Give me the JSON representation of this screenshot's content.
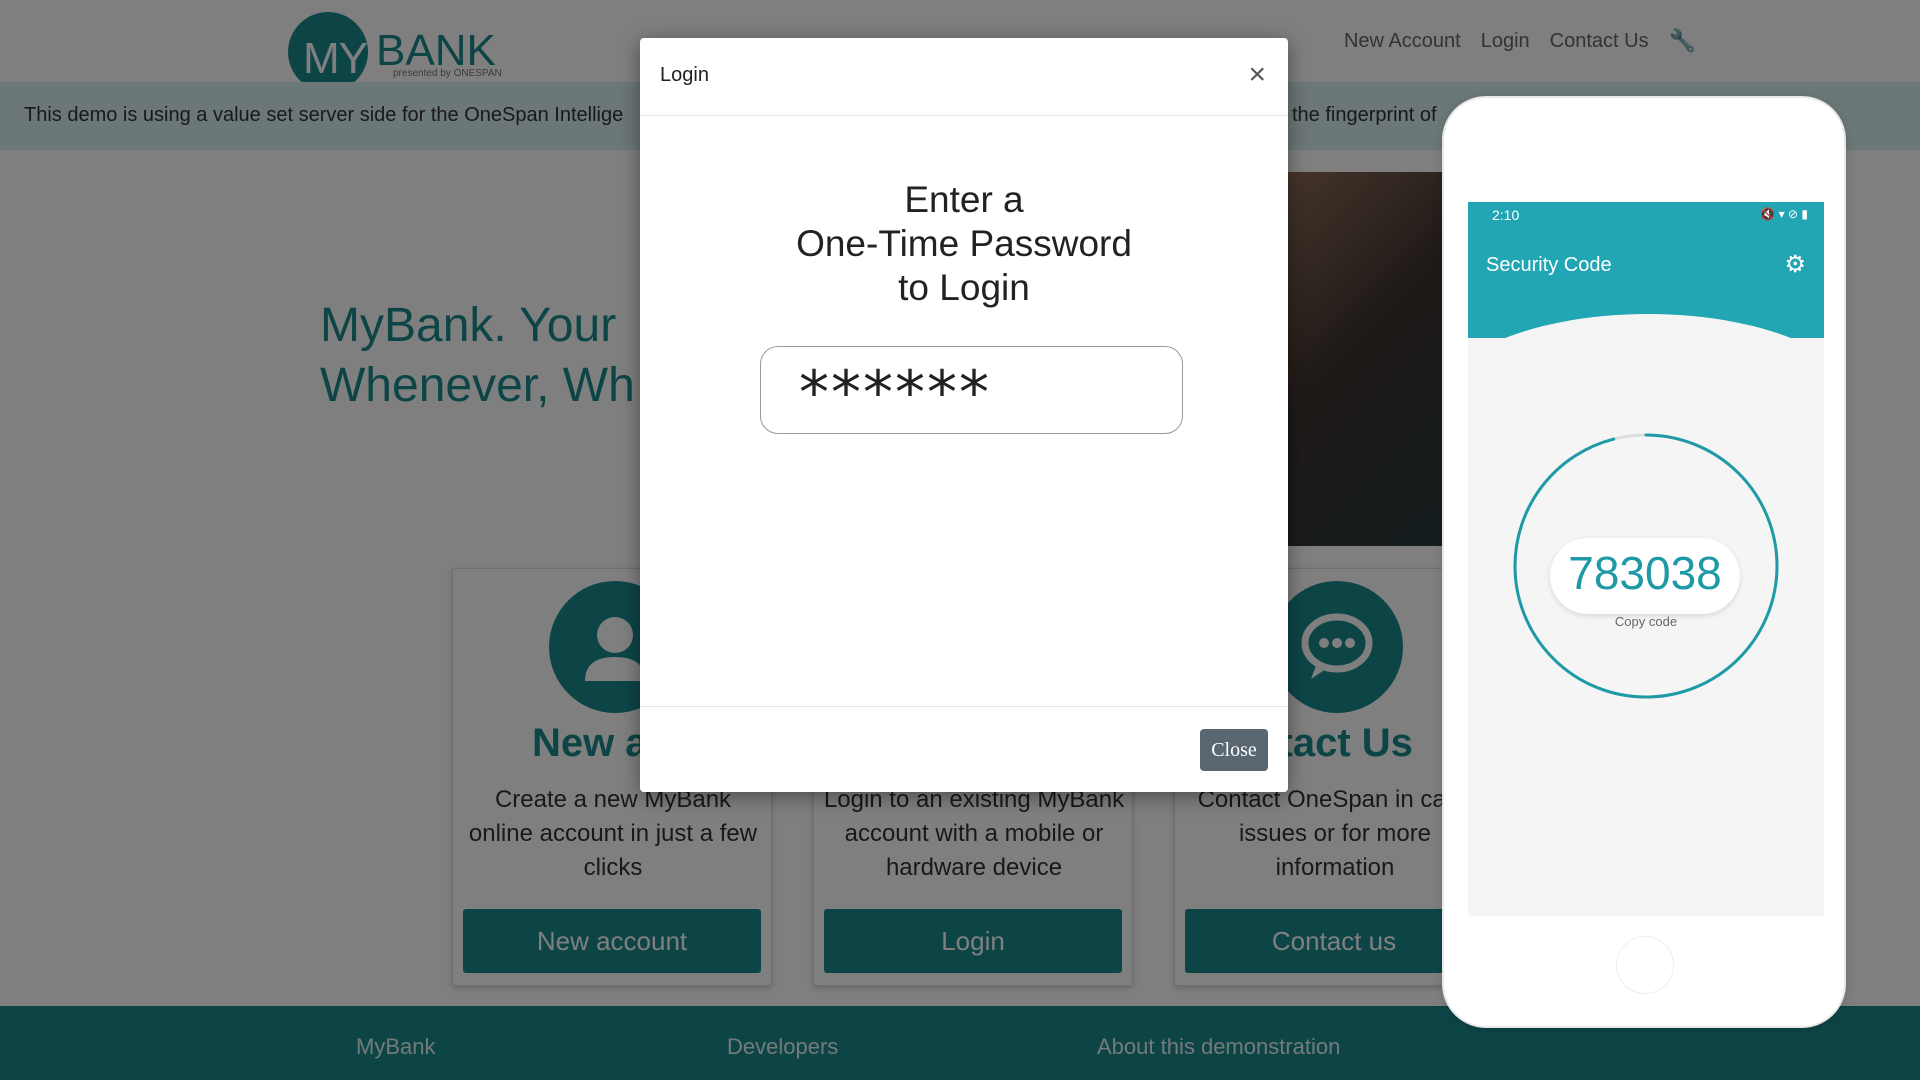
{
  "header": {
    "logo_my": "MY",
    "logo_bank": "BANK",
    "logo_sub": "presented by ONESPAN",
    "nav": [
      "New Account",
      "Login",
      "Contact Us"
    ],
    "wrench_icon": "wrench-icon"
  },
  "banner": {
    "text_left": "This demo is using a value set server side for the OneSpan Intellige",
    "text_right": "the fingerprint of"
  },
  "hero": {
    "title_line1": "MyBank. Your",
    "title_line2": "Whenever, Wh"
  },
  "cards": [
    {
      "title": "New acc",
      "desc": "Create a new MyBank online account in just a few clicks",
      "button": "New account",
      "icon": "user-icon"
    },
    {
      "title": "",
      "desc": "Login to an existing MyBank account with a mobile or hardware device",
      "button": "Login",
      "icon": "login-icon"
    },
    {
      "title": "ntact Us",
      "desc": "Contact OneSpan in ca of issues or for more information",
      "button": "Contact us",
      "icon": "chat-icon"
    }
  ],
  "footer": {
    "col1": "MyBank",
    "col2": "Developers",
    "col3": "About this demonstration"
  },
  "modal": {
    "title": "Login",
    "close_x": "×",
    "heading_line1": "Enter a",
    "heading_line2": "One-Time Password",
    "heading_line3": "to Login",
    "otp_value": "******",
    "close_button": "Close"
  },
  "phone": {
    "status_time": "2:10",
    "status_icons": "🔇 ▾ ⊘ ▮",
    "app_title": "Security Code",
    "code": "783038",
    "copy_label": "Copy code",
    "ring_progress": 0.96
  },
  "colors": {
    "accent": "#1a8a8f",
    "phone_accent": "#22a6b3"
  }
}
